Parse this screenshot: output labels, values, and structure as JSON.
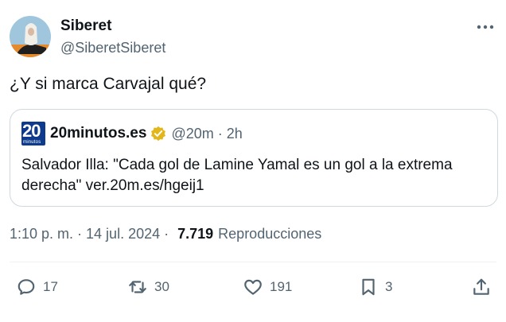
{
  "tweet": {
    "author_name": "Siberet",
    "author_handle": "@SiberetSiberet",
    "text": "¿Y si marca Carvajal qué?",
    "timestamp": "1:10 p. m. · 14 jul. 2024",
    "views_count": "7.719",
    "views_label": "Reproducciones"
  },
  "quote": {
    "logo_number": "20",
    "logo_sub": "minutos",
    "source_name": "20minutos.es",
    "source_handle": "@20m",
    "separator": "·",
    "time": "2h",
    "text": "Salvador Illa: \"Cada gol de Lamine Yamal es un gol a la extrema derecha\" ver.20m.es/hgeij1"
  },
  "actions": {
    "replies": "17",
    "reposts": "30",
    "likes": "191",
    "bookmarks": "3"
  },
  "meta": {
    "dot": "·"
  },
  "colors": {
    "text_primary": "#0f1419",
    "text_secondary": "#536471",
    "border": "#cfd9de",
    "verified_gold": "#e2b719",
    "logo_blue": "#0d3a8c"
  },
  "icons": [
    "more-icon",
    "verified-icon",
    "reply-icon",
    "repost-icon",
    "like-icon",
    "bookmark-icon",
    "share-icon"
  ]
}
